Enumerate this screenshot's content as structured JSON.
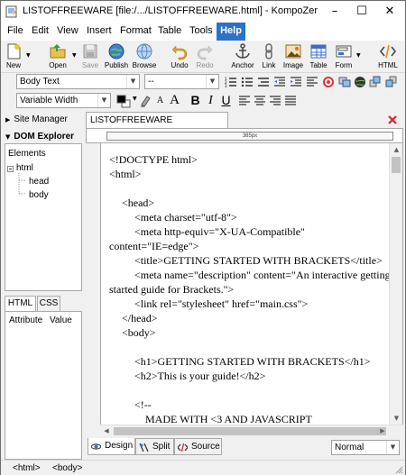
{
  "window": {
    "title": "LISTOFFREEWARE [file:/.../LISTOFFREEWARE.html] - KompoZer"
  },
  "menu": [
    "File",
    "Edit",
    "View",
    "Insert",
    "Format",
    "Table",
    "Tools",
    "Help"
  ],
  "toolbar": [
    {
      "label": "New",
      "icon": "new-icon"
    },
    {
      "label": "Open",
      "icon": "open-icon"
    },
    {
      "label": "Save",
      "icon": "save-icon"
    },
    {
      "label": "Publish",
      "icon": "publish-icon"
    },
    {
      "label": "Browse",
      "icon": "browse-icon"
    },
    {
      "label": "Undo",
      "icon": "undo-icon"
    },
    {
      "label": "Redo",
      "icon": "redo-icon"
    },
    {
      "label": "Anchor",
      "icon": "anchor-icon"
    },
    {
      "label": "Link",
      "icon": "link-icon"
    },
    {
      "label": "Image",
      "icon": "image-icon"
    },
    {
      "label": "Table",
      "icon": "table-icon"
    },
    {
      "label": "Form",
      "icon": "form-icon"
    },
    {
      "label": "HTML",
      "icon": "html-icon"
    }
  ],
  "format": {
    "paragraph_style": "Body Text",
    "second_select": "--",
    "font": "Variable Width"
  },
  "sidebar": {
    "site_manager": "Site Manager",
    "dom_explorer": "DOM Explorer",
    "elements_label": "Elements",
    "tree": [
      "html",
      "head",
      "body"
    ],
    "tabs": [
      "HTML",
      "CSS"
    ],
    "attr_col": "Attribute",
    "value_col": "Value"
  },
  "document": {
    "tab": "LISTOFFREEWARE",
    "ruler": "385px",
    "code_lines": [
      "<!DOCTYPE html>",
      "<html>",
      "",
      "<head>",
      "<meta charset=\"utf-8\">",
      "<meta http-equiv=\"X-UA-Compatible\"",
      "content=\"IE=edge\">",
      "<title>GETTING STARTED WITH BRACKETS</title>",
      "<meta name=\"description\" content=\"An interactive getting",
      "started guide for Brackets.\">",
      "<link rel=\"stylesheet\" href=\"main.css\">",
      "</head>",
      "<body>",
      "",
      "<h1>GETTING STARTED WITH BRACKETS</h1>",
      "<h2>This is your guide!</h2>",
      "",
      "<!--",
      "MADE WITH <3 AND JAVASCRIPT"
    ]
  },
  "modes": [
    "Design",
    "Split",
    "Source"
  ],
  "view_mode": "Normal",
  "status": [
    "<html>",
    "<body>"
  ]
}
